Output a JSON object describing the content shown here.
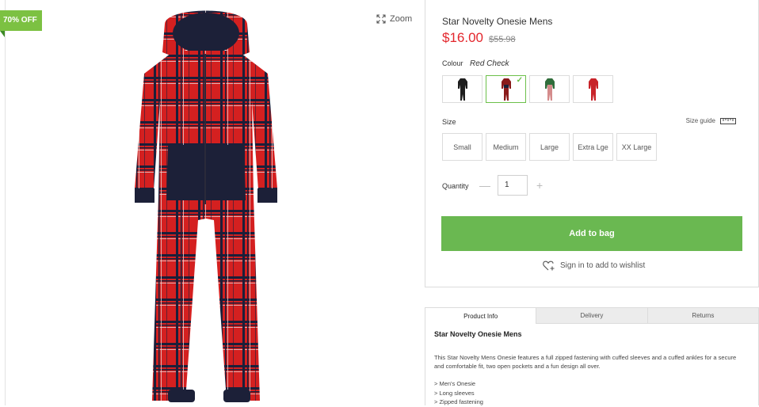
{
  "badge": {
    "text": "70% OFF"
  },
  "gallery": {
    "zoom_label": "Zoom"
  },
  "product": {
    "title": "Star Novelty Onesie Mens",
    "price": "$16.00",
    "was_price": "$55.98"
  },
  "colour": {
    "label": "Colour",
    "selected": "Red Check",
    "swatches": [
      {
        "name": "black",
        "color": "#1e1e1e"
      },
      {
        "name": "red-check",
        "color": "#8a1a1a",
        "selected": true
      },
      {
        "name": "green",
        "color": "#2f6e3b"
      },
      {
        "name": "red",
        "color": "#c8242a"
      }
    ]
  },
  "size": {
    "label": "Size",
    "guide_label": "Size guide",
    "options": [
      "Small",
      "Medium",
      "Large",
      "Extra Lge",
      "XX Large"
    ]
  },
  "quantity": {
    "label": "Quantity",
    "value": "1"
  },
  "actions": {
    "add_to_bag": "Add to bag",
    "wishlist": "Sign in to add to wishlist"
  },
  "info": {
    "tabs": [
      "Product Info",
      "Delivery",
      "Returns"
    ],
    "title": "Star Novelty Onesie Mens",
    "description": "This Star Novelty Mens Onesie features a full zipped fastening with cuffed sleeves and a cuffed ankles for a secure and comfortable fit, two open pockets and a fun design all over.",
    "bullets": [
      "> Men's Onesie",
      "> Long sleeves",
      "> Zipped fastening"
    ]
  },
  "colors": {
    "accent": "#6ab851",
    "price": "#e3262c",
    "badge": "#7cc142"
  }
}
